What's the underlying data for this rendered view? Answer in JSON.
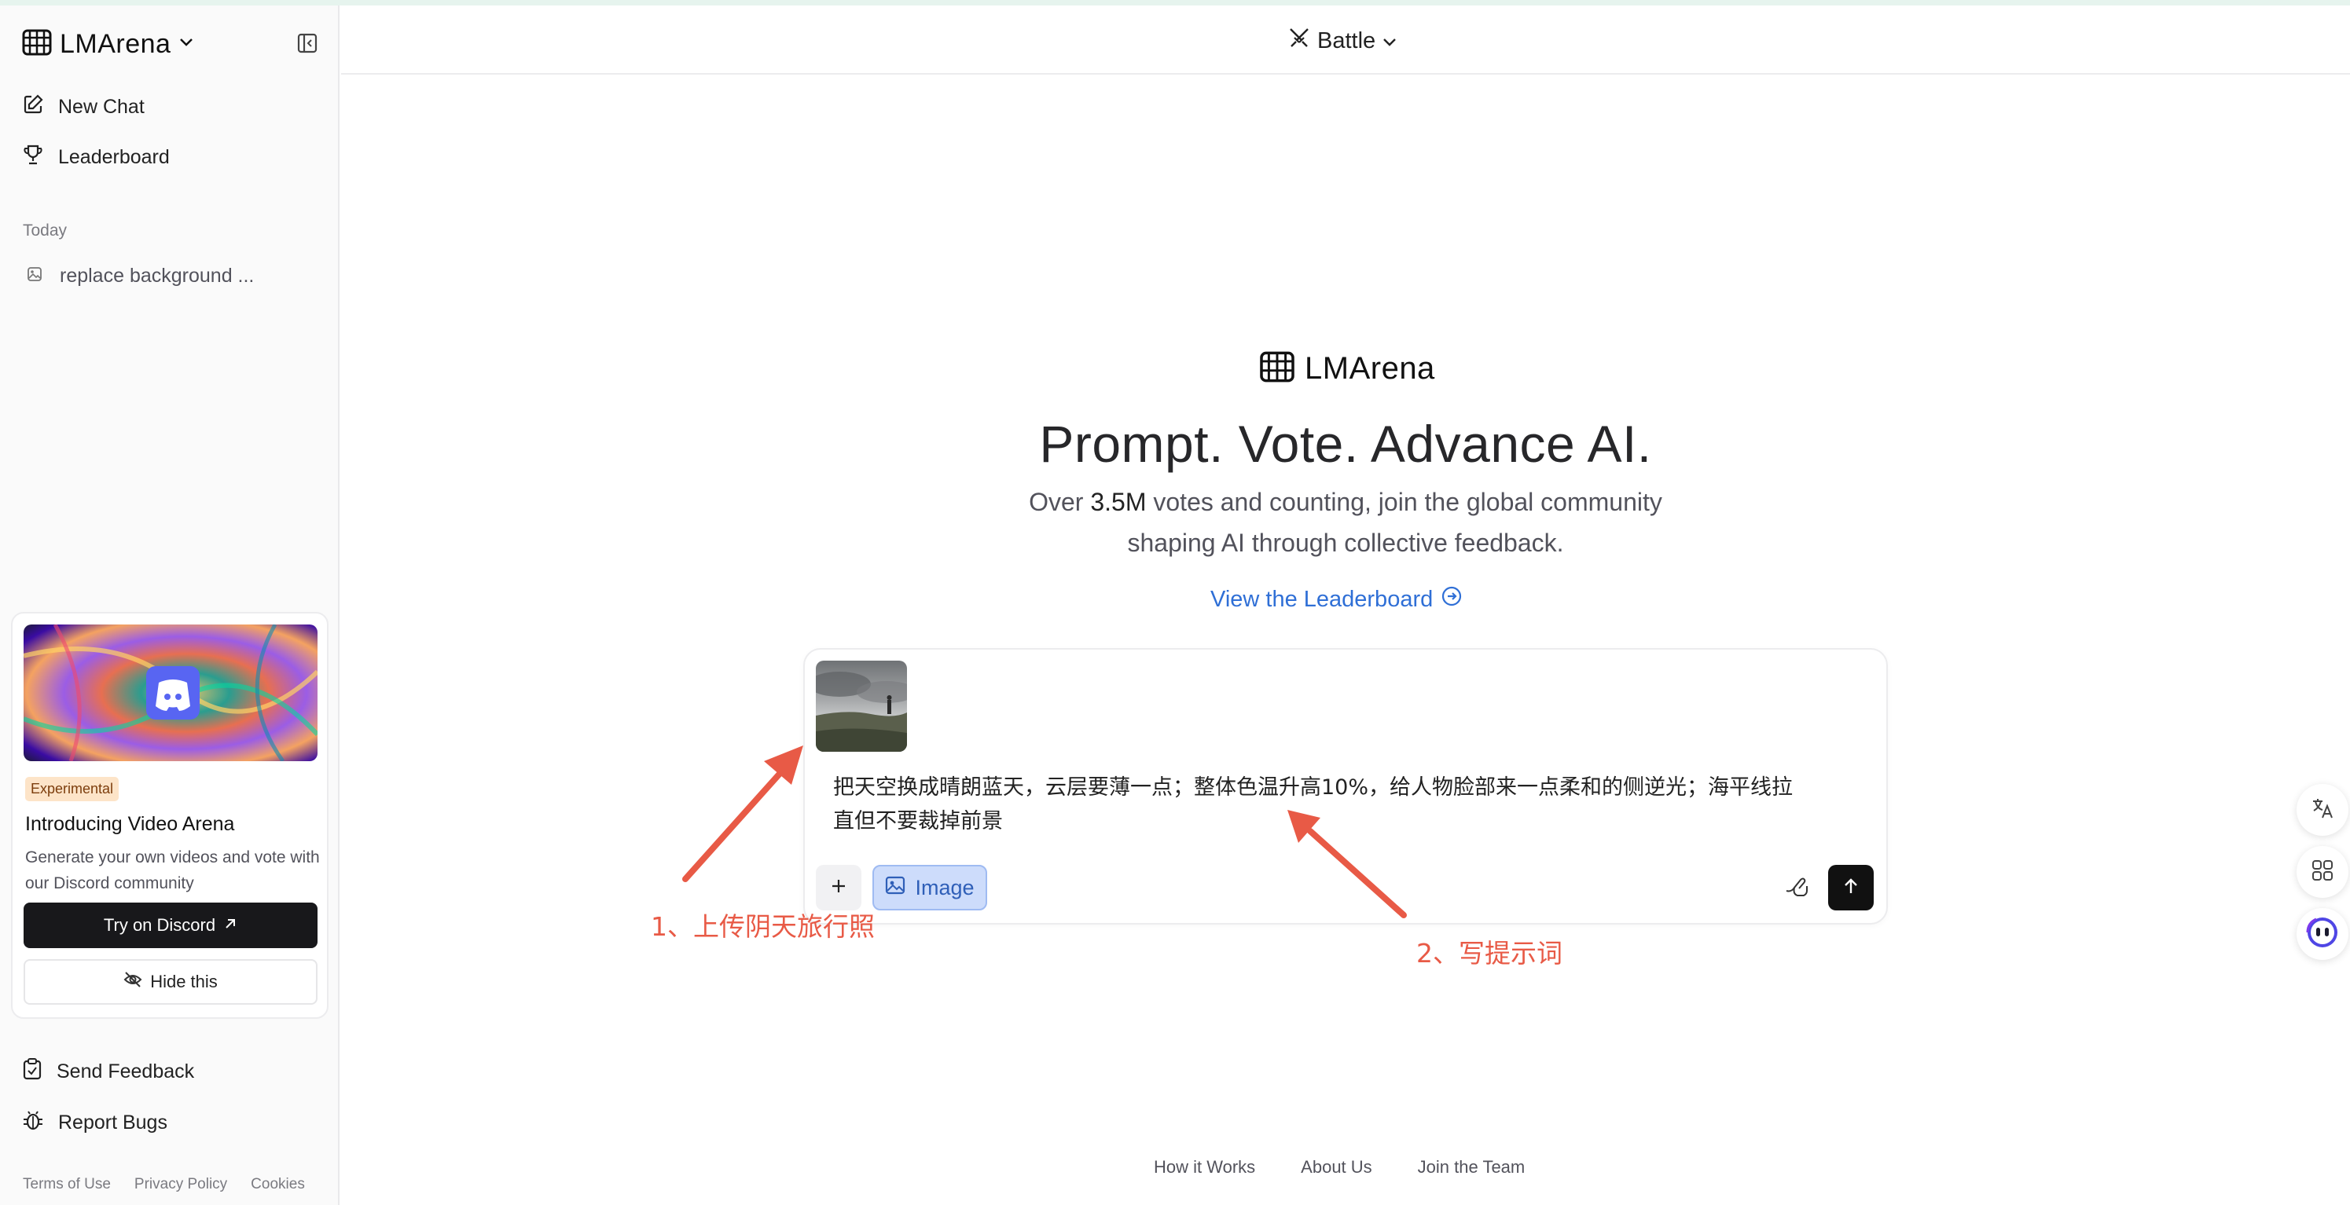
{
  "sidebar": {
    "brand": "LMArena",
    "nav": {
      "new_chat": "New Chat",
      "leaderboard": "Leaderboard"
    },
    "section_today": "Today",
    "history": [
      {
        "label": "replace background ..."
      }
    ],
    "promo": {
      "badge": "Experimental",
      "title": "Introducing Video Arena",
      "description": "Generate your own videos and vote with our Discord community",
      "cta": "Try on Discord",
      "hide": "Hide this"
    },
    "bottom_nav": {
      "feedback": "Send Feedback",
      "bugs": "Report Bugs"
    },
    "footer": {
      "terms": "Terms of Use",
      "privacy": "Privacy Policy",
      "cookies": "Cookies"
    }
  },
  "header": {
    "mode": "Battle"
  },
  "hero": {
    "brand": "LMArena",
    "title": "Prompt. Vote. Advance AI.",
    "sub_before": "Over ",
    "sub_count": "3.5M",
    "sub_line1_after": " votes and counting, join the global community",
    "sub_line2": "shaping AI through collective feedback.",
    "link": "View the Leaderboard"
  },
  "composer": {
    "prompt_line1": "把天空换成晴朗蓝天，云层要薄一点；整体色温升高10%，给人物脸部来一点柔和的侧逆光；海平线拉",
    "prompt_line2": "直但不要裁掉前景",
    "image_chip": "Image"
  },
  "annotations": {
    "step1": "1、上传阴天旅行照",
    "step2": "2、写提示词"
  },
  "bottom_links": {
    "how": "How it Works",
    "about": "About Us",
    "join": "Join the Team"
  },
  "colors": {
    "accent_link": "#2f6fd6",
    "annotation": "#e85a46",
    "chip_bg": "#cddcfb",
    "badge_bg": "#fde4c8"
  },
  "icons": [
    "grid-logo-icon",
    "chevron-down-icon",
    "sidebar-collapse-icon",
    "edit-icon",
    "trophy-icon",
    "image-icon",
    "discord-icon",
    "arrow-up-right-icon",
    "eye-off-icon",
    "feedback-icon",
    "bug-icon",
    "swords-icon",
    "arrow-circle-right-icon",
    "plus-icon",
    "gesture-icon",
    "arrow-up-icon",
    "translate-icon",
    "apps-icon",
    "assistant-icon"
  ]
}
